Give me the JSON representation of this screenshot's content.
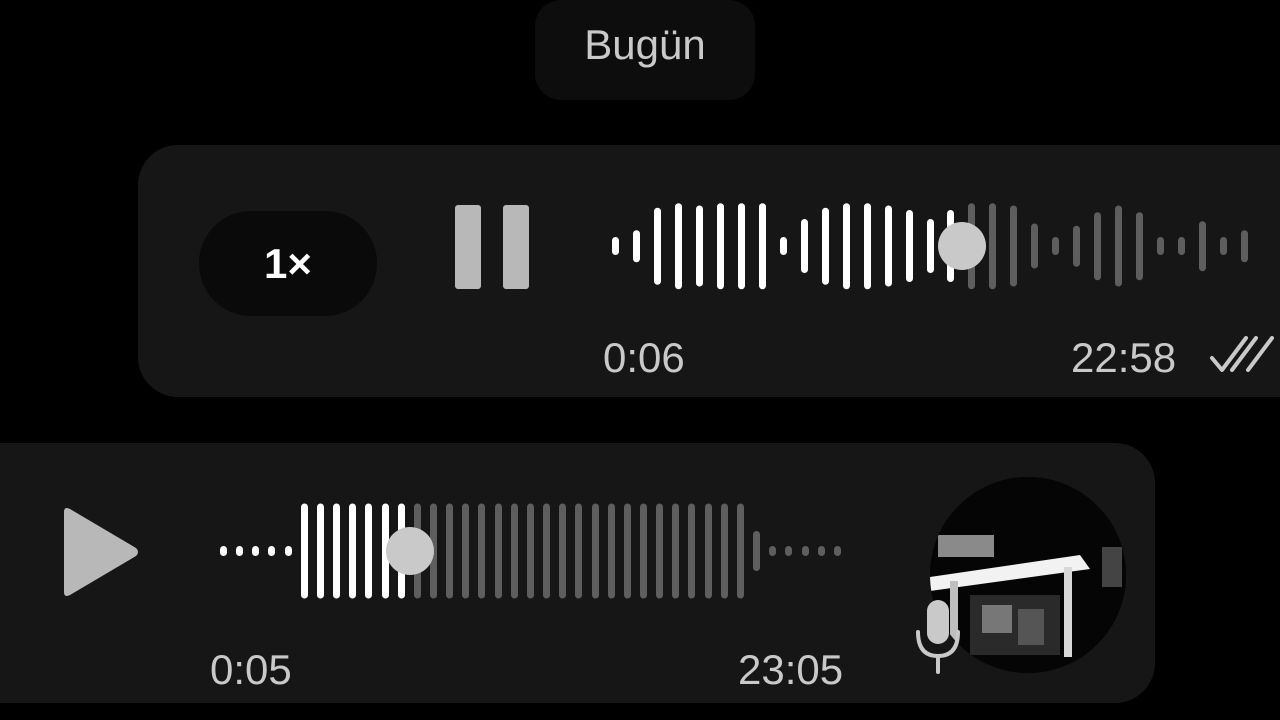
{
  "chat": {
    "date_label": "Bugün"
  },
  "outgoing_voice": {
    "speed_label": "1×",
    "play_state_icon": "pause-icon",
    "duration": "0:06",
    "sent_time": "22:58",
    "status_icon": "double-check-icon",
    "progress": 0.54,
    "waveform_levels": [
      0.2,
      0.35,
      0.85,
      0.95,
      0.9,
      0.95,
      0.95,
      0.95,
      0.2,
      0.6,
      0.85,
      0.95,
      0.95,
      0.9,
      0.8,
      0.6,
      0.8,
      0.95,
      0.95,
      0.9,
      0.5,
      0.2,
      0.45,
      0.75,
      0.9,
      0.75,
      0.2,
      0.2,
      0.55,
      0.2,
      0.35
    ]
  },
  "incoming_voice": {
    "play_state_icon": "play-icon",
    "duration": "0:05",
    "sent_time": "23:05",
    "progress": 0.32,
    "waveform_levels": [
      0.1,
      0.1,
      0.1,
      0.1,
      0.1,
      0.95,
      0.95,
      0.95,
      0.95,
      0.95,
      0.95,
      0.95,
      0.95,
      0.95,
      0.95,
      0.95,
      0.95,
      0.95,
      0.95,
      0.95,
      0.95,
      0.95,
      0.95,
      0.95,
      0.95,
      0.95,
      0.95,
      0.95,
      0.95,
      0.95,
      0.95,
      0.95,
      0.95,
      0.4,
      0.1,
      0.1,
      0.1,
      0.1,
      0.1
    ],
    "attachment_icon": "microphone-icon"
  },
  "colors": {
    "background": "#000000",
    "bubble": "#161616",
    "played": "#ffffff",
    "unplayed": "#5e5e5e",
    "muted_text": "#c9c9c9"
  }
}
